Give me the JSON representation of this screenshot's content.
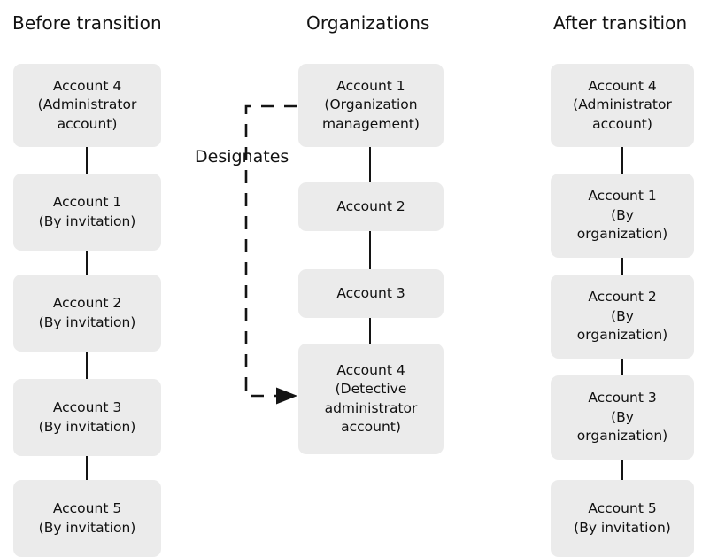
{
  "diagram": {
    "title_left": "Before transition",
    "title_middle": "Organizations",
    "title_right": "After transition",
    "edge_label_designates": "Designates",
    "colors": {
      "node_fill": "#ebebeb",
      "line": "#141414",
      "text": "#101010",
      "background": "#ffffff"
    },
    "columns": {
      "before": {
        "heading": "Before transition",
        "nodes": [
          {
            "label": "Account 4\n(Administrator\naccount)"
          },
          {
            "label": "Account 1\n(By invitation)"
          },
          {
            "label": "Account 2\n(By invitation)"
          },
          {
            "label": "Account 3\n(By invitation)"
          },
          {
            "label": "Account 5\n(By invitation)"
          }
        ]
      },
      "organizations": {
        "heading": "Organizations",
        "nodes": [
          {
            "label": "Account 1\n(Organization\nmanagement)"
          },
          {
            "label": "Account 2"
          },
          {
            "label": "Account 3"
          },
          {
            "label": "Account 4\n(Detective\nadministrator\naccount)"
          }
        ]
      },
      "after": {
        "heading": "After transition",
        "nodes": [
          {
            "label": "Account 4\n(Administrator\naccount)"
          },
          {
            "label": "Account 1\n(By\norganization)"
          },
          {
            "label": "Account 2\n(By\norganization)"
          },
          {
            "label": "Account 3\n(By\norganization)"
          },
          {
            "label": "Account 5\n(By invitation)"
          }
        ]
      }
    }
  }
}
